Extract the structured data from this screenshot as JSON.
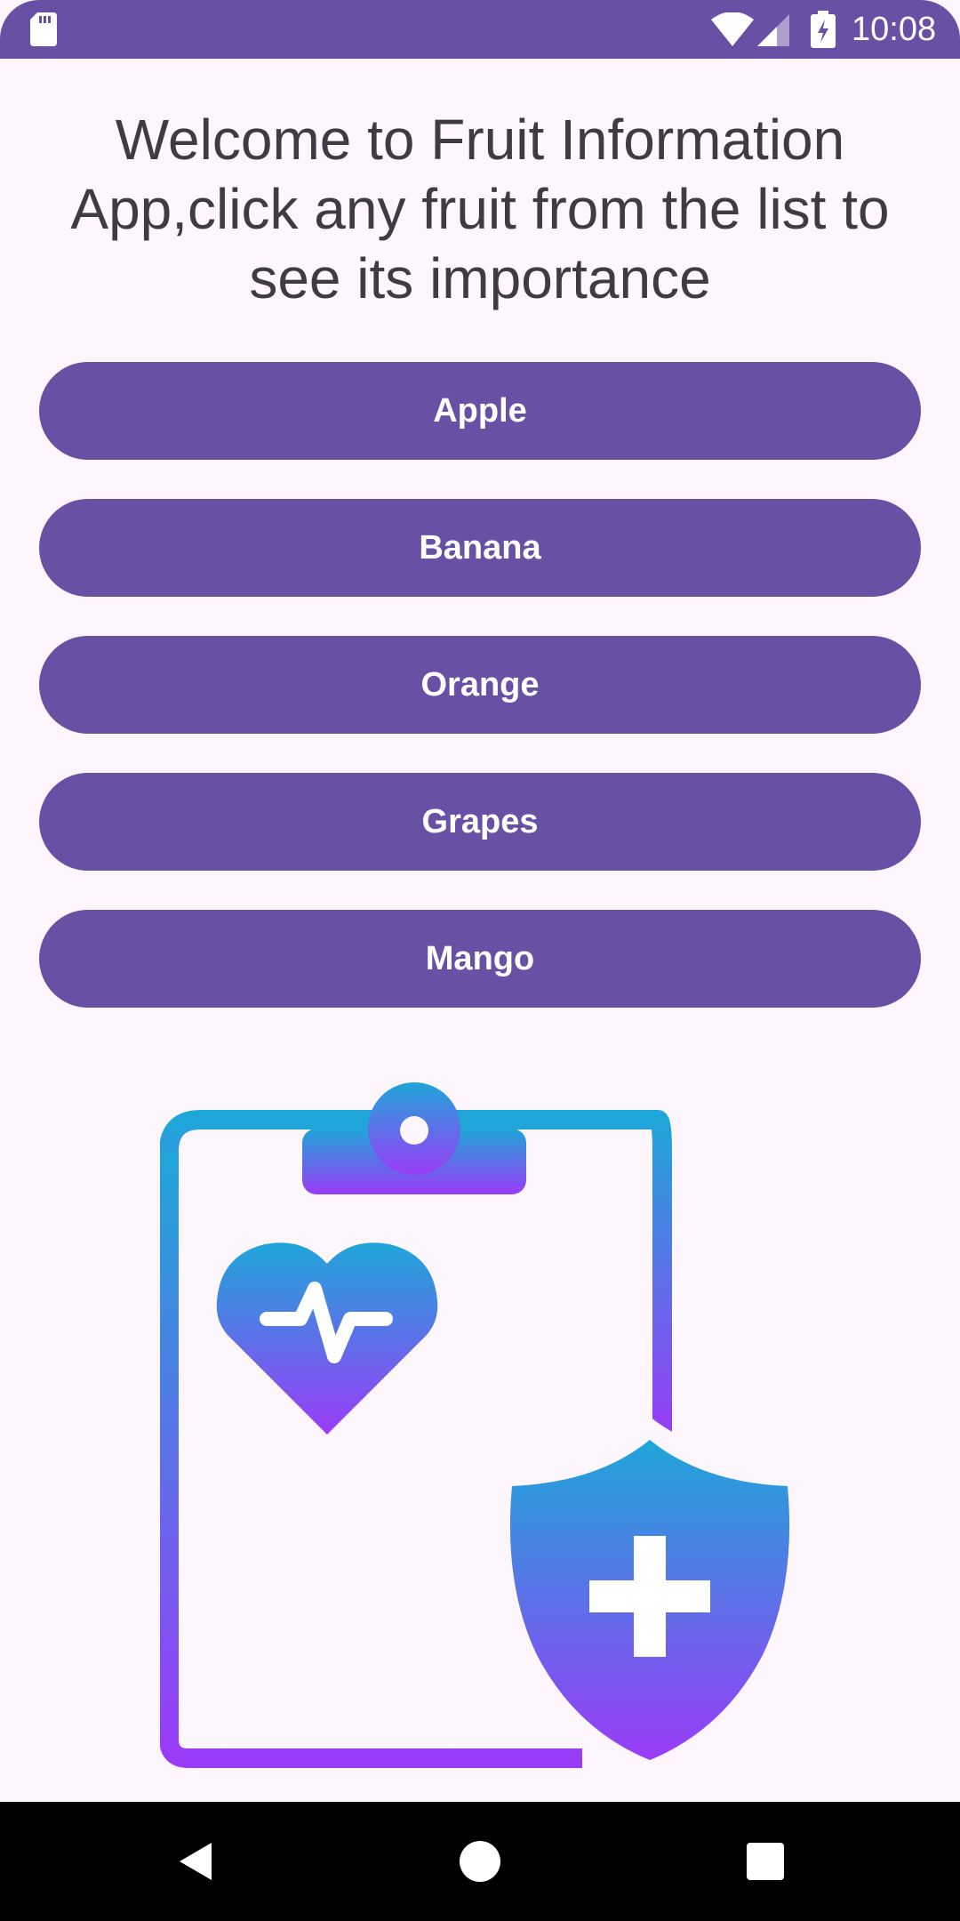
{
  "status_bar": {
    "time": "10:08",
    "background_color": "#6851a4",
    "icons": [
      "sd-card-icon",
      "wifi-icon",
      "cell-signal-icon",
      "battery-charging-icon"
    ]
  },
  "welcome_text": "Welcome to Fruit Information App,click any fruit from the list to see its importance",
  "fruits": [
    {
      "label": "Apple"
    },
    {
      "label": "Banana"
    },
    {
      "label": "Orange"
    },
    {
      "label": "Grapes"
    },
    {
      "label": "Mango"
    }
  ],
  "button_color": "#6851a4",
  "illustration": {
    "icon": "medical-clipboard-shield-icon",
    "gradient_top": "#1fa6d9",
    "gradient_bottom": "#9a3cf7"
  },
  "nav_bar": {
    "icons": [
      "back-icon",
      "home-icon",
      "recents-icon"
    ]
  }
}
